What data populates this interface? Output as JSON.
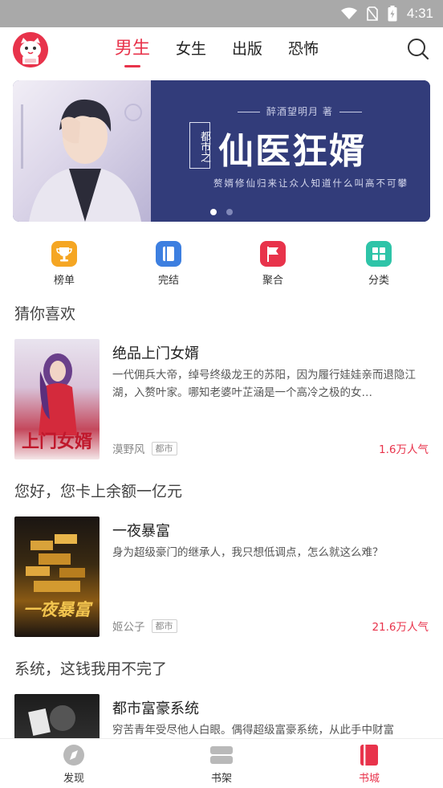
{
  "status_bar": {
    "time": "4:31"
  },
  "top_nav": {
    "tabs": [
      {
        "label": "男生",
        "active": true
      },
      {
        "label": "女生",
        "active": false
      },
      {
        "label": "出版",
        "active": false
      },
      {
        "label": "恐怖",
        "active": false
      }
    ],
    "accent_color": "#e8334b"
  },
  "banner": {
    "author": "醉酒望明月 著",
    "title_prefix": "都市之",
    "title": "仙医狂婿",
    "subtitle": "赘婿修仙归来让众人知道什么叫高不可攀",
    "page_count": 2,
    "active_page": 0
  },
  "quick_links": [
    {
      "label": "榜单",
      "icon": "trophy-icon",
      "color": "#f5a623"
    },
    {
      "label": "完结",
      "icon": "book-icon",
      "color": "#3d7fe0"
    },
    {
      "label": "聚合",
      "icon": "flag-icon",
      "color": "#e8334b"
    },
    {
      "label": "分类",
      "icon": "grid-icon",
      "color": "#2ec4a8"
    }
  ],
  "sections": [
    {
      "title": "猜你喜欢",
      "book": {
        "title": "绝品上门女婿",
        "description": "一代佣兵大帝，绰号终级龙王的苏阳，因为履行娃娃亲而退隐江湖，入赘叶家。哪知老婆叶芷涵是一个高冷之极的女…",
        "author": "漠野风",
        "tag": "都市",
        "popularity": "1.6万人气",
        "cover_text": "上门女婿"
      }
    },
    {
      "title": "您好，您卡上余额一亿元",
      "book": {
        "title": "一夜暴富",
        "description": "身为超级豪门的继承人，我只想低调点，怎么就这么难？",
        "author": "姬公子",
        "tag": "都市",
        "popularity": "21.6万人气",
        "cover_text": "一夜暴富"
      }
    },
    {
      "title": "系统，这钱我用不完了",
      "book": {
        "title": "都市富豪系统",
        "description": "穷苦青年受尽他人白眼。偶得超级富豪系统，从此手中财富"
      }
    }
  ],
  "bottom_nav": [
    {
      "label": "发现",
      "icon": "compass-icon",
      "active": false
    },
    {
      "label": "书架",
      "icon": "bookshelf-icon",
      "active": false
    },
    {
      "label": "书城",
      "icon": "bookstore-icon",
      "active": true
    }
  ]
}
